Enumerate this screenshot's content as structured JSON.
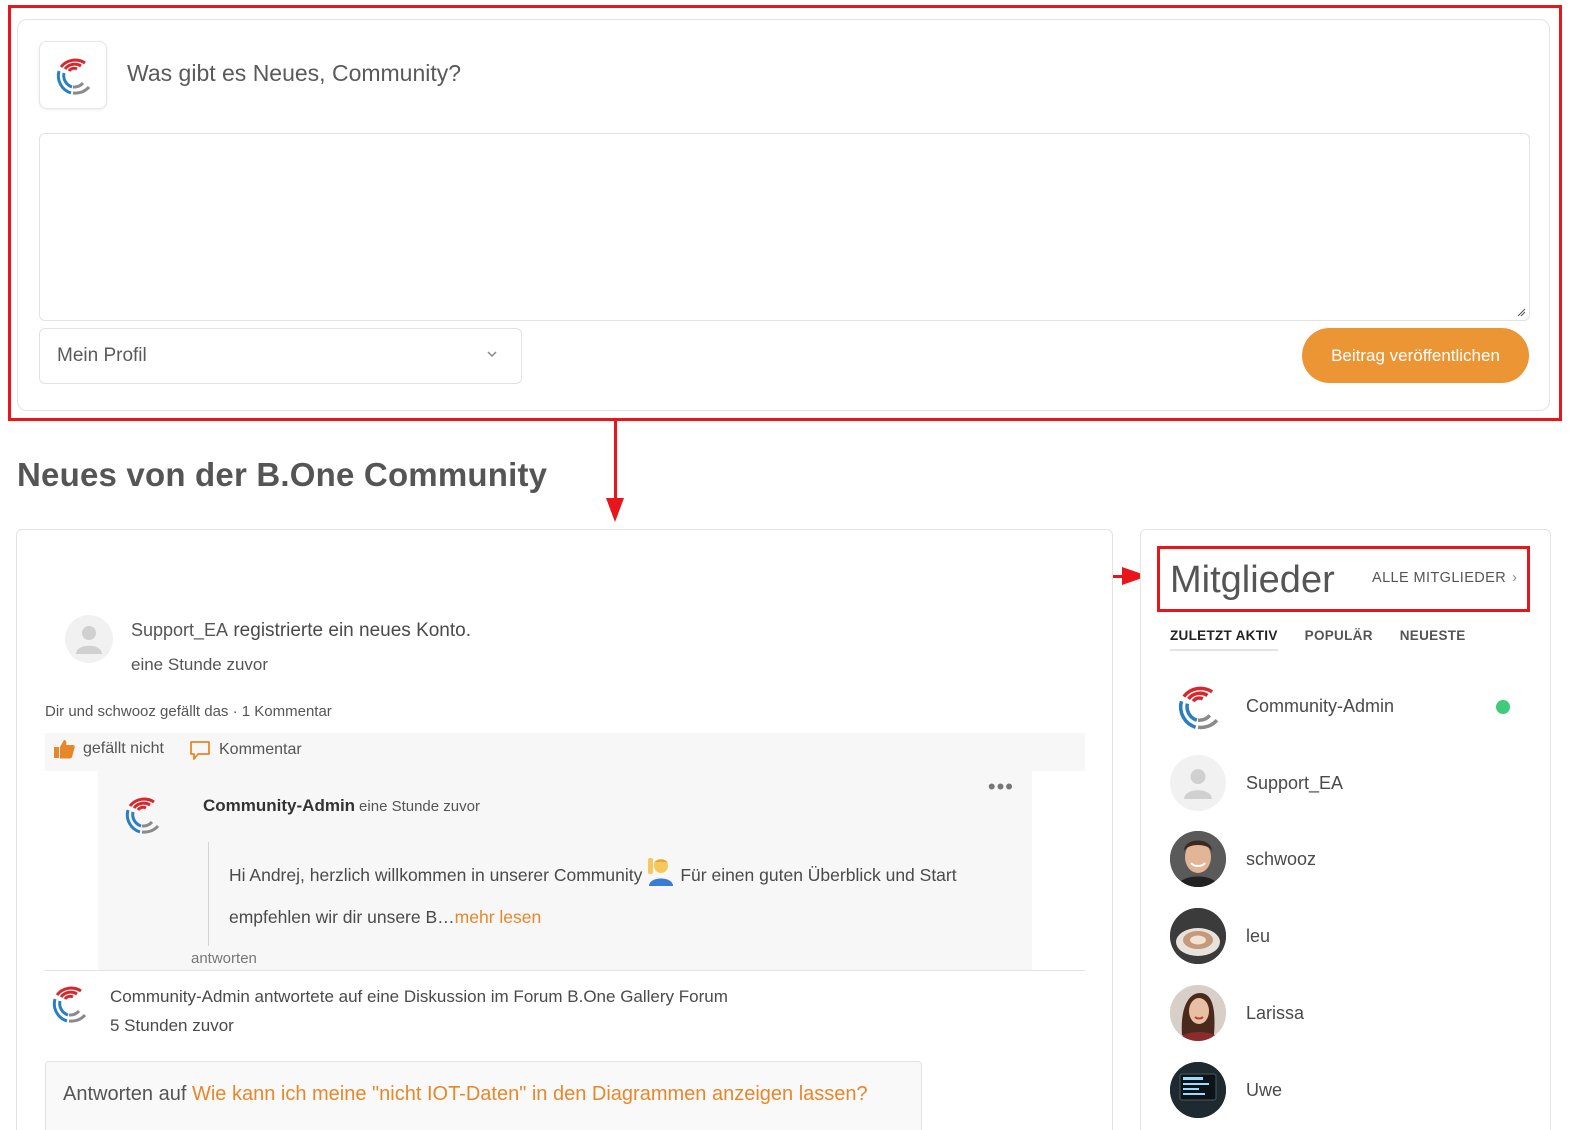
{
  "composer": {
    "prompt": "Was gibt es Neues, Community?",
    "textarea_value": "",
    "visibility_selected": "Mein Profil",
    "publish_label": "Beitrag veröffentlichen"
  },
  "feed": {
    "section_title": "Neues von der B.One Community",
    "activity1": {
      "user": "Support_EA",
      "action": " registrierte ein neues Konto.",
      "time": "eine Stunde zuvor",
      "likes": "Dir und schwooz gefällt das · 1 Kommentar",
      "like_label": "gefällt nicht",
      "comment_label": "Kommentar"
    },
    "comment": {
      "author": "Community-Admin",
      "time": "eine Stunde zuvor",
      "more": "•••",
      "text_before": "Hi Andrej, herzlich willkommen in unserer Community",
      "text_after": "Für einen guten Überblick und Start empfehlen wir dir unsere B…",
      "read_more": "mehr lesen",
      "reply_label": "antworten"
    },
    "activity2": {
      "text": "Community-Admin antwortete auf eine Diskussion im Forum B.One Gallery Forum",
      "time": "5 Stunden zuvor",
      "reply_prefix": "Antworten auf ",
      "reply_topic": "Wie kann ich meine \"nicht IOT-Daten\" in den Diagrammen anzeigen lassen?"
    }
  },
  "members": {
    "title": "Mitglieder",
    "all_link": "ALLE MITGLIEDER",
    "all_link_chevron": "›",
    "tabs": [
      "ZULETZT AKTIV",
      "POPULÄR",
      "NEUESTE"
    ],
    "list": [
      {
        "name": "Community-Admin",
        "online": true
      },
      {
        "name": "Support_EA",
        "online": false
      },
      {
        "name": "schwooz",
        "online": false
      },
      {
        "name": "leu",
        "online": false
      },
      {
        "name": "Larissa",
        "online": false
      },
      {
        "name": "Uwe",
        "online": false
      }
    ]
  },
  "colors": {
    "accent": "#eb9535",
    "link": "#e8872a",
    "annotation": "#e8161b",
    "online": "#3ecb7a"
  }
}
